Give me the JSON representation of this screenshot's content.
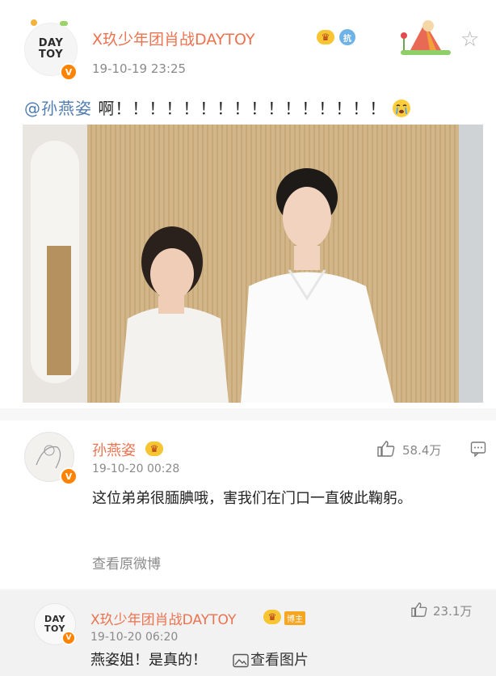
{
  "post": {
    "author": "X玖少年团肖战DAYTOY",
    "timestamp": "19-10-19 23:25",
    "avatar_logo_line1": "DAY",
    "avatar_logo_line2": "TOY",
    "mention": "@孙燕姿",
    "text": " 啊！！！！！！！！！！！！！！！！",
    "emoji": "cry-emoji"
  },
  "comments": [
    {
      "author": "孙燕姿",
      "timestamp": "19-10-20 00:28",
      "likes": "58.4万",
      "body": "这位弟弟很腼腆哦，害我们在门口一直彼此鞠躬。",
      "link": "查看原微博"
    },
    {
      "author": "X玖少年团肖战DAYTOY",
      "badge": "博主",
      "timestamp": "19-10-20 06:20",
      "likes": "23.1万",
      "body": "燕姿姐！是真的！",
      "link": "查看图片",
      "avatar_logo_line1": "DAY",
      "avatar_logo_line2": "TOY"
    }
  ],
  "colors": {
    "username": "#eb7350",
    "mention": "#507daf",
    "verified": "#ff8200",
    "crown": "#f7c532"
  }
}
